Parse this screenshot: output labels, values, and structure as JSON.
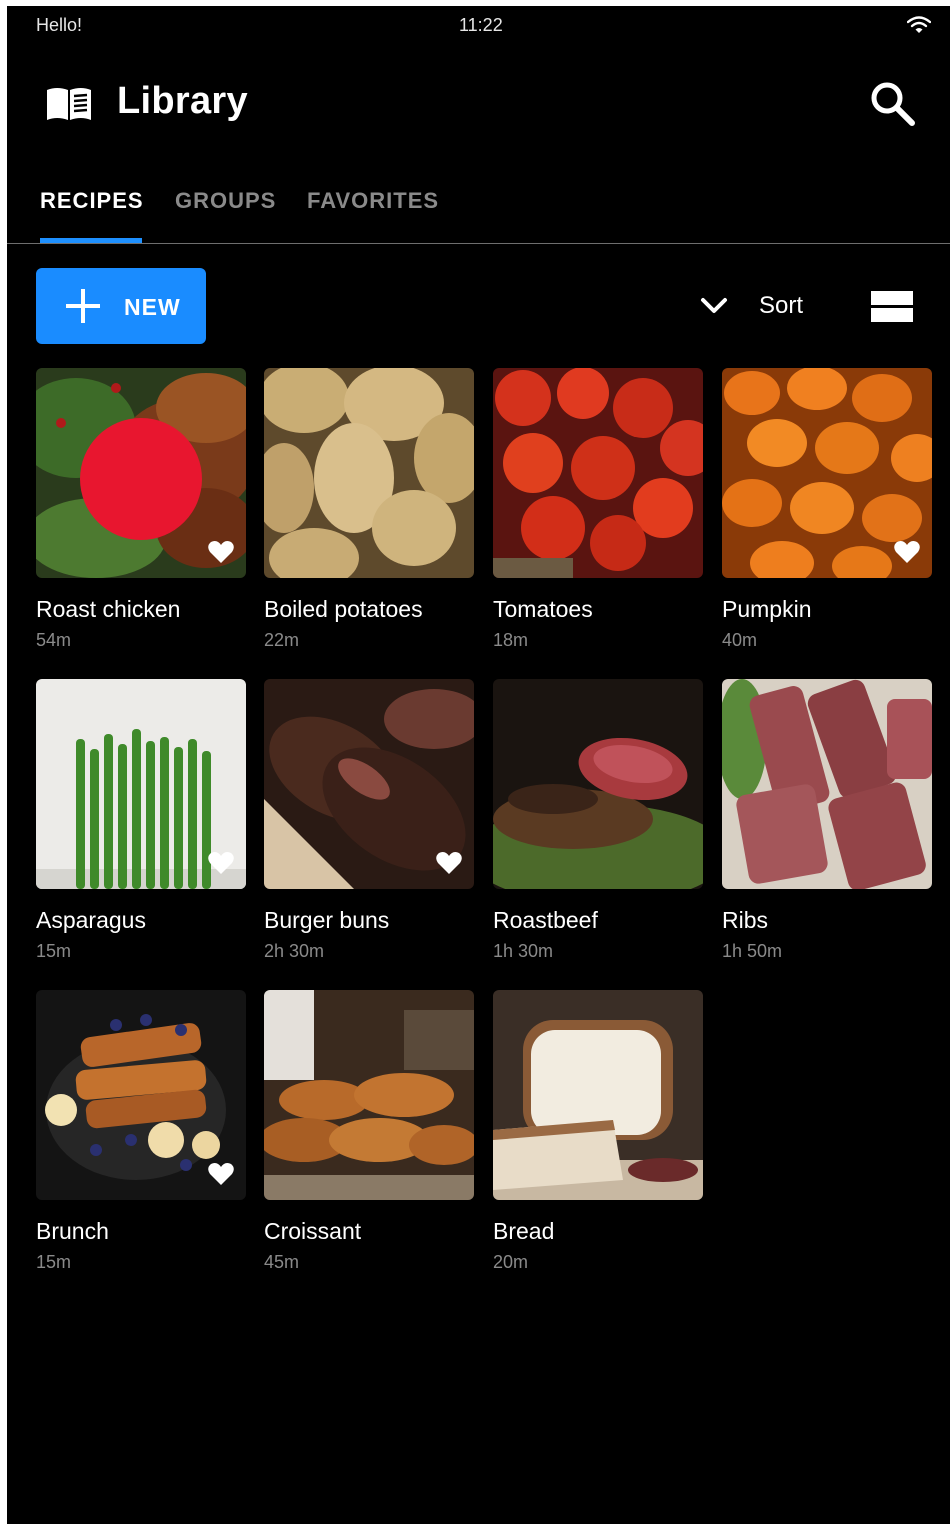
{
  "status_bar": {
    "greeting": "Hello!",
    "time": "11:22"
  },
  "app_bar": {
    "title": "Library"
  },
  "tabs": [
    {
      "label": "RECIPES",
      "active": true
    },
    {
      "label": "GROUPS",
      "active": false
    },
    {
      "label": "FAVORITES",
      "active": false
    }
  ],
  "toolbar": {
    "new_label": "NEW",
    "sort_label": "Sort"
  },
  "colors": {
    "accent": "#1a8cff",
    "background": "#000000",
    "record_dot": "#e8162f"
  },
  "recipes": [
    {
      "name": "Roast chicken",
      "time": "54m",
      "favorite": true
    },
    {
      "name": "Boiled potatoes",
      "time": "22m",
      "favorite": false
    },
    {
      "name": "Tomatoes",
      "time": "18m",
      "favorite": false
    },
    {
      "name": "Pumpkin",
      "time": "40m",
      "favorite": true
    },
    {
      "name": "Asparagus",
      "time": "15m",
      "favorite": true
    },
    {
      "name": "Burger buns",
      "time": "2h 30m",
      "favorite": true
    },
    {
      "name": "Roastbeef",
      "time": "1h 30m",
      "favorite": false
    },
    {
      "name": "Ribs",
      "time": "1h 50m",
      "favorite": false
    },
    {
      "name": "Brunch",
      "time": "15m",
      "favorite": true
    },
    {
      "name": "Croissant",
      "time": "45m",
      "favorite": false
    },
    {
      "name": "Bread",
      "time": "20m",
      "favorite": false
    }
  ]
}
